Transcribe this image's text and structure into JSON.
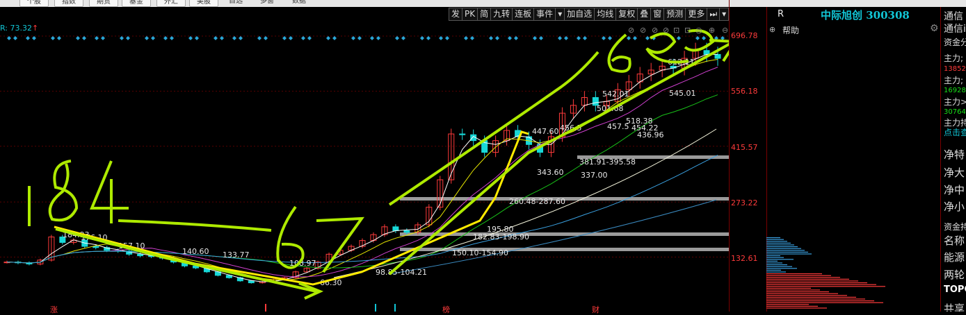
{
  "top_tabs": [
    "个股",
    "指数",
    "期货",
    "基金",
    "外汇",
    "美股"
  ],
  "top_labels": [
    "自选",
    "多窗",
    "数据"
  ],
  "toolbar": [
    "发",
    "PK",
    "简",
    "九转",
    "连板",
    "事件",
    "▾",
    "加自选",
    "均线",
    "复权",
    "叠",
    "窗",
    "预测",
    "更多",
    "⏭",
    "▾"
  ],
  "indicator": {
    "text": "R: 73.32",
    "arrow": "↑"
  },
  "y_axis": [
    "696.78",
    "556.18",
    "415.57",
    "273.22",
    "132.61"
  ],
  "chart_data": {
    "type": "line",
    "title": "",
    "ylim": [
      66.3,
      696.78
    ],
    "y_ticks": [
      696.78,
      556.18,
      415.57,
      273.22,
      132.61
    ],
    "series": [
      {
        "values": [
          120,
          118,
          115,
          125,
          184,
          170,
          176,
          160,
          157,
          150,
          148,
          140,
          136,
          134,
          130,
          120,
          110,
          105,
          95,
          86,
          80,
          72,
          67,
          70,
          75,
          80,
          95,
          104,
          120,
          140,
          150,
          160,
          175,
          190,
          210,
          200,
          196,
          215,
          260,
          330,
          447,
          445,
          430,
          400,
          430,
          456,
          440,
          420,
          400,
          440,
          500,
          520,
          540,
          520,
          530,
          560,
          580,
          600,
          610,
          620,
          615,
          640,
          660,
          650,
          640
        ]
      }
    ],
    "price_labels": [
      "184.93",
      "176.10",
      "157.10",
      "140.60",
      "133.77",
      "108.97",
      "66.30",
      "98.85-104.21",
      "150.10-154.90",
      "182.83-198.90",
      "195.80",
      "260.48-287.60",
      "343.60",
      "447.60",
      "456.5",
      "381.91-395.58",
      "337.00",
      "542.01",
      "501.68",
      "457.5",
      "454.22",
      "436.96",
      "518.38",
      "545.01",
      "612.11"
    ]
  },
  "right_panel": {
    "r_label": "R",
    "stock_name": "中际旭创 300308",
    "help": "帮助",
    "far_right": [
      "通信",
      "通信i",
      "资金分",
      "主力;",
      "13852",
      "主力;",
      "16928",
      "主力>",
      "30764",
      "主力持",
      "点击查",
      "净特",
      "净大",
      "净中",
      "净小",
      "资金持",
      "名称",
      "能源",
      "两轮",
      "TOPO",
      "共享"
    ]
  },
  "bottom_markers": [
    "涨",
    "榜",
    "财"
  ],
  "colors": {
    "up": "#ff3b3b",
    "accent": "#11c6d6",
    "annotation": "#aeea00",
    "trend": "#ffea00"
  }
}
